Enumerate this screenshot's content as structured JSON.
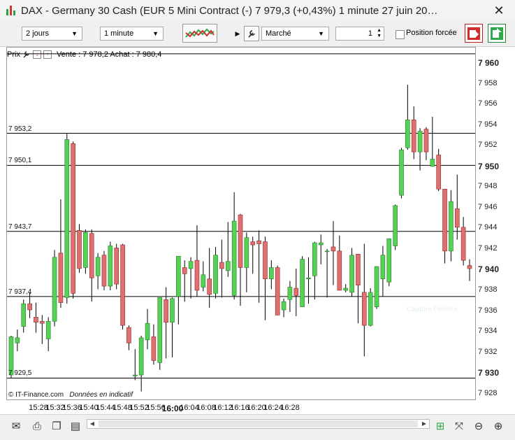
{
  "window": {
    "title": "DAX - Germany 30 Cash (EUR 5 Mini Contract (-)   7 979,3 (+0,43%)   1 minute  27 juin 20…",
    "close_glyph": "✕"
  },
  "toolbar": {
    "period_value": "2 jours",
    "interval_value": "1 minute",
    "order_type_value": "Marché",
    "quantity_value": "1",
    "forced_position_label": "Position forcée",
    "forced_position_checked": false
  },
  "chart": {
    "header_label": "Prix",
    "quote_text": "Vente : 7 978,2 Achat : 7 980,4",
    "footer_source": "© IT-Finance.com",
    "footer_note": "Données en indicatif",
    "watermark": "Capture Fenêtre"
  },
  "statusbar": {
    "icons": [
      "mail-icon",
      "print-icon",
      "copy-icon",
      "document-icon",
      "chart-add-icon",
      "zoom-fit-icon",
      "zoom-out-icon",
      "zoom-in-icon"
    ]
  },
  "colors": {
    "bull": "#55d155",
    "bear": "#e07070",
    "bull_border": "#2a7a2a",
    "bear_border": "#8a2a2a",
    "sell_button": "#d42b2b",
    "buy_button": "#2fa84a"
  },
  "chart_data": {
    "type": "candlestick",
    "instrument": "DAX - Germany 30 Cash",
    "last_price_label": "7 940",
    "ylim": [
      7927.5,
      7961.5
    ],
    "y_ticks": [
      7960,
      7958,
      7956,
      7954,
      7952,
      7950,
      7948,
      7946,
      7944,
      7942,
      7940,
      7938,
      7936,
      7934,
      7932,
      7930,
      7928
    ],
    "y_tick_labels": [
      "7 960",
      "7 958",
      "7 956",
      "7 954",
      "7 952",
      "7 950",
      "7 948",
      "7 946",
      "7 944",
      "7 942",
      "7 940",
      "7 938",
      "7 936",
      "7 934",
      "7 932",
      "7 930",
      "7 928"
    ],
    "bold_y_ticks": [
      7960,
      7950,
      7940,
      7930
    ],
    "horizontal_lines": [
      {
        "value": 7960.9,
        "label": ""
      },
      {
        "value": 7953.2,
        "label": "7 953,2"
      },
      {
        "value": 7950.1,
        "label": "7 950,1"
      },
      {
        "value": 7943.7,
        "label": "7 943,7"
      },
      {
        "value": 7937.4,
        "label": "7 937,4"
      },
      {
        "value": 7929.5,
        "label": "7 929,5"
      }
    ],
    "x_tick_labels": [
      "15:28",
      "15:32",
      "15:36",
      "15:40",
      "15:44",
      "15:48",
      "15:52",
      "15:56",
      "16:00",
      "16:04",
      "16:08",
      "16:12",
      "16:16",
      "16:20",
      "16:24",
      "16:28"
    ],
    "bold_x_tick": "16:00",
    "candles": [
      {
        "o": 7929.8,
        "h": 7933.6,
        "l": 7929.5,
        "c": 7933.5
      },
      {
        "o": 7932.9,
        "h": 7934.2,
        "l": 7932.1,
        "c": 7933.4
      },
      {
        "o": 7934.5,
        "h": 7937.1,
        "l": 7933.9,
        "c": 7936.7
      },
      {
        "o": 7936.7,
        "h": 7937.8,
        "l": 7935.3,
        "c": 7936.1
      },
      {
        "o": 7935.4,
        "h": 7936.8,
        "l": 7933.9,
        "c": 7934.9
      },
      {
        "o": 7935.0,
        "h": 7935.6,
        "l": 7932.8,
        "c": 7934.8
      },
      {
        "o": 7933.3,
        "h": 7935.4,
        "l": 7932.1,
        "c": 7935.0
      },
      {
        "o": 7935.0,
        "h": 7941.9,
        "l": 7934.5,
        "c": 7941.2
      },
      {
        "o": 7941.6,
        "h": 7946.8,
        "l": 7936.3,
        "c": 7936.8
      },
      {
        "o": 7937.3,
        "h": 7953.2,
        "l": 7936.7,
        "c": 7952.6
      },
      {
        "o": 7952.2,
        "h": 7952.4,
        "l": 7937.2,
        "c": 7937.7
      },
      {
        "o": 7943.8,
        "h": 7944.4,
        "l": 7939.7,
        "c": 7940.1
      },
      {
        "o": 7940.2,
        "h": 7943.9,
        "l": 7939.6,
        "c": 7943.6
      },
      {
        "o": 7943.5,
        "h": 7943.9,
        "l": 7936.9,
        "c": 7939.2
      },
      {
        "o": 7939.4,
        "h": 7941.6,
        "l": 7938.1,
        "c": 7941.2
      },
      {
        "o": 7941.4,
        "h": 7941.8,
        "l": 7938.0,
        "c": 7938.4
      },
      {
        "o": 7938.4,
        "h": 7942.7,
        "l": 7938.0,
        "c": 7942.3
      },
      {
        "o": 7942.1,
        "h": 7942.5,
        "l": 7938.1,
        "c": 7938.6
      },
      {
        "o": 7942.4,
        "h": 7942.5,
        "l": 7934.2,
        "c": 7934.6
      },
      {
        "o": 7934.4,
        "h": 7934.6,
        "l": 7932.2,
        "c": 7932.9
      },
      {
        "o": 7929.7,
        "h": 7932.3,
        "l": 7929.3,
        "c": 7929.8
      },
      {
        "o": 7929.8,
        "h": 7933.6,
        "l": 7928.2,
        "c": 7933.4
      },
      {
        "o": 7933.2,
        "h": 7936.2,
        "l": 7932.3,
        "c": 7934.8
      },
      {
        "o": 7933.5,
        "h": 7934.7,
        "l": 7930.8,
        "c": 7931.2
      },
      {
        "o": 7931.0,
        "h": 7936.8,
        "l": 7930.3,
        "c": 7937.3
      },
      {
        "o": 7937.1,
        "h": 7938.3,
        "l": 7931.4,
        "c": 7934.9
      },
      {
        "o": 7934.9,
        "h": 7937.3,
        "l": 7931.5,
        "c": 7937.2
      },
      {
        "o": 7937.4,
        "h": 7941.3,
        "l": 7934.7,
        "c": 7941.3
      },
      {
        "o": 7940.2,
        "h": 7940.9,
        "l": 7936.9,
        "c": 7939.6
      },
      {
        "o": 7940.1,
        "h": 7941.2,
        "l": 7937.2,
        "c": 7940.8
      },
      {
        "o": 7940.9,
        "h": 7944.3,
        "l": 7937.4,
        "c": 7938.0
      },
      {
        "o": 7938.3,
        "h": 7940.8,
        "l": 7937.9,
        "c": 7939.5
      },
      {
        "o": 7939.1,
        "h": 7942.1,
        "l": 7936.3,
        "c": 7937.6
      },
      {
        "o": 7937.7,
        "h": 7942.2,
        "l": 7937.2,
        "c": 7941.4
      },
      {
        "o": 7940.7,
        "h": 7942.9,
        "l": 7937.3,
        "c": 7940.1
      },
      {
        "o": 7939.9,
        "h": 7944.6,
        "l": 7939.3,
        "c": 7940.8
      },
      {
        "o": 7937.5,
        "h": 7947.5,
        "l": 7937.1,
        "c": 7944.7
      },
      {
        "o": 7945.3,
        "h": 7945.4,
        "l": 7936.5,
        "c": 7940.2
      },
      {
        "o": 7940.2,
        "h": 7943.6,
        "l": 7937.8,
        "c": 7943.1
      },
      {
        "o": 7942.7,
        "h": 7943.2,
        "l": 7939.6,
        "c": 7942.4
      },
      {
        "o": 7942.8,
        "h": 7943.8,
        "l": 7936.8,
        "c": 7942.5
      },
      {
        "o": 7942.7,
        "h": 7943.2,
        "l": 7935.1,
        "c": 7939.1
      },
      {
        "o": 7939.1,
        "h": 7940.9,
        "l": 7938.1,
        "c": 7940.2
      },
      {
        "o": 7940.2,
        "h": 7940.4,
        "l": 7935.6,
        "c": 7935.6
      },
      {
        "o": 7936.1,
        "h": 7937.2,
        "l": 7935.4,
        "c": 7936.9
      },
      {
        "o": 7937.1,
        "h": 7938.9,
        "l": 7935.9,
        "c": 7938.3
      },
      {
        "o": 7938.2,
        "h": 7940.1,
        "l": 7935.5,
        "c": 7937.5
      },
      {
        "o": 7936.4,
        "h": 7941.3,
        "l": 7937.4,
        "c": 7941.0
      },
      {
        "o": 7939.1,
        "h": 7941.2,
        "l": 7936.7,
        "c": 7939.2
      },
      {
        "o": 7939.4,
        "h": 7942.7,
        "l": 7937.1,
        "c": 7942.6
      },
      {
        "o": 7942.4,
        "h": 7943.4,
        "l": 7940.5,
        "c": 7942.6
      },
      {
        "o": 7941.8,
        "h": 7942.0,
        "l": 7937.3,
        "c": 7941.8
      },
      {
        "o": 7942.2,
        "h": 7944.7,
        "l": 7938.5,
        "c": 7941.8
      },
      {
        "o": 7941.8,
        "h": 7943.3,
        "l": 7938.3,
        "c": 7938.0
      },
      {
        "o": 7938.0,
        "h": 7938.6,
        "l": 7937.8,
        "c": 7938.2
      },
      {
        "o": 7937.8,
        "h": 7942.1,
        "l": 7937.4,
        "c": 7941.4
      },
      {
        "o": 7941.5,
        "h": 7941.5,
        "l": 7934.8,
        "c": 7938.5
      },
      {
        "o": 7937.8,
        "h": 7942.5,
        "l": 7931.6,
        "c": 7934.6
      },
      {
        "o": 7934.6,
        "h": 7938.2,
        "l": 7934.5,
        "c": 7937.8
      },
      {
        "o": 7936.4,
        "h": 7940.3,
        "l": 7936.2,
        "c": 7940.3
      },
      {
        "o": 7939.1,
        "h": 7942.3,
        "l": 7937.4,
        "c": 7941.4
      },
      {
        "o": 7938.8,
        "h": 7942.7,
        "l": 7938.4,
        "c": 7943.0
      },
      {
        "o": 7942.3,
        "h": 7946.3,
        "l": 7941.9,
        "c": 7946.2
      },
      {
        "o": 7947.2,
        "h": 7951.8,
        "l": 7946.9,
        "c": 7951.6
      },
      {
        "o": 7951.8,
        "h": 7957.9,
        "l": 7951.6,
        "c": 7954.5
      },
      {
        "o": 7954.5,
        "h": 7955.8,
        "l": 7950.7,
        "c": 7951.4
      },
      {
        "o": 7951.4,
        "h": 7953.7,
        "l": 7949.6,
        "c": 7953.4
      },
      {
        "o": 7953.6,
        "h": 7953.8,
        "l": 7950.6,
        "c": 7951.4
      },
      {
        "o": 7950.0,
        "h": 7954.8,
        "l": 7950.1,
        "c": 7950.7
      },
      {
        "o": 7951.1,
        "h": 7951.7,
        "l": 7947.6,
        "c": 7947.8
      },
      {
        "o": 7947.8,
        "h": 7947.7,
        "l": 7940.6,
        "c": 7941.8
      },
      {
        "o": 7941.8,
        "h": 7947.7,
        "l": 7940.8,
        "c": 7946.6
      },
      {
        "o": 7945.9,
        "h": 7949.2,
        "l": 7942.9,
        "c": 7944.1
      },
      {
        "o": 7944.1,
        "h": 7945.1,
        "l": 7940.4,
        "c": 7940.9
      },
      {
        "o": 7940.4,
        "h": 7941.0,
        "l": 7938.9,
        "c": 7940.1
      }
    ]
  }
}
